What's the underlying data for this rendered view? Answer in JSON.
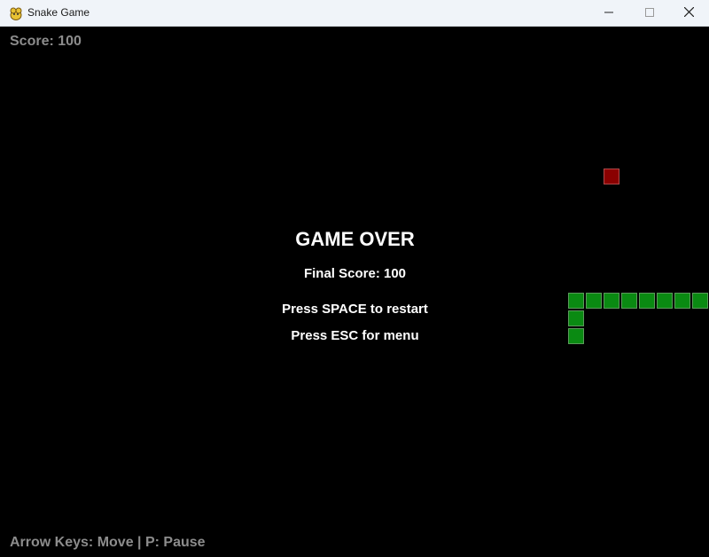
{
  "window": {
    "title": "Snake Game",
    "icon": "pygame-snake-icon"
  },
  "hud": {
    "score_text": "Score: 100",
    "controls_text": "Arrow Keys: Move | P: Pause"
  },
  "game_over": {
    "title": "GAME OVER",
    "final_score": "Final Score: 100",
    "restart_hint": "Press SPACE to restart",
    "menu_hint": "Press ESC for menu"
  },
  "colors": {
    "background": "#000000",
    "snake": "#0a8a12",
    "food": "#8a0000",
    "hud_text": "#8c8c8c"
  }
}
